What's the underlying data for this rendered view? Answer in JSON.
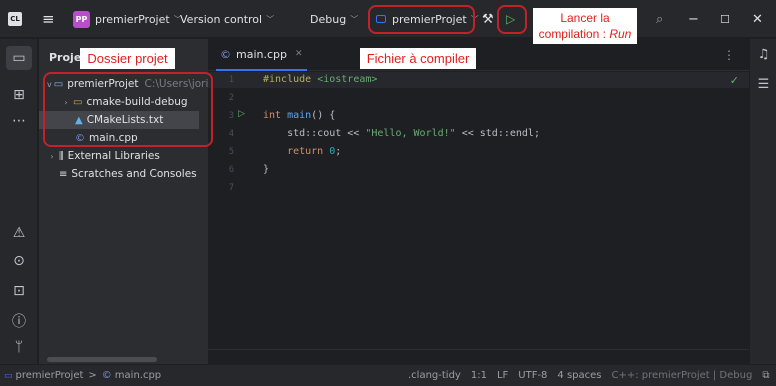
{
  "titlebar": {
    "app_icon_text": "CL",
    "menu_icon": "hamburger-icon",
    "project_badge": "PP",
    "project_name": "premierProjet",
    "vcs_label": "Version control",
    "build_config": "Debug",
    "run_config": "premierProjet"
  },
  "project_panel": {
    "header": "Project",
    "tree": [
      {
        "label": "premierProjet",
        "hint": "C:\\Users\\jori",
        "icon": "folder-icon",
        "expanded": true
      },
      {
        "label": "cmake-build-debug",
        "icon": "folder-icon",
        "expanded": false
      },
      {
        "label": "CMakeLists.txt",
        "icon": "cmake-icon"
      },
      {
        "label": "main.cpp",
        "icon": "cpp-file-icon"
      },
      {
        "label": "External Libraries",
        "icon": "library-icon",
        "expanded": false
      },
      {
        "label": "Scratches and Consoles",
        "icon": "scratches-icon"
      }
    ]
  },
  "editor": {
    "tab_label": "main.cpp",
    "line_numbers": [
      "1",
      "2",
      "3",
      "4",
      "5",
      "6",
      "7"
    ],
    "lines": {
      "l1_directive": "#include",
      "l1_header": " <iostream>",
      "l3_type": "int",
      "l3_fn": " main",
      "l3_rest": "() {",
      "l4_pre": "    std::cout << ",
      "l4_str": "\"Hello, World!\"",
      "l4_post": " << std::endl;",
      "l5_kw": "    return",
      "l5_num": " 0",
      "l5_end": ";",
      "l6": "}"
    }
  },
  "statusbar": {
    "module_icon": "module-icon",
    "crumb_project": "premierProjet",
    "crumb_sep": ">",
    "crumb_file": "main.cpp",
    "linter": ".clang-tidy",
    "position": "1:1",
    "line_ending": "LF",
    "encoding": "UTF-8",
    "indent": "4 spaces",
    "context": "C++: premierProjet | Debug"
  },
  "annotations": {
    "dossier": "Dossier projet",
    "fichier": "Fichier à compiler",
    "lancer_line1": "Lancer la",
    "lancer_line2": "compilation : ",
    "lancer_run": "Run"
  },
  "colors": {
    "accent": "#3574f0",
    "run_green": "#5fb865",
    "annotation_red": "#e0201f",
    "project_badge": "#b84ecb"
  }
}
